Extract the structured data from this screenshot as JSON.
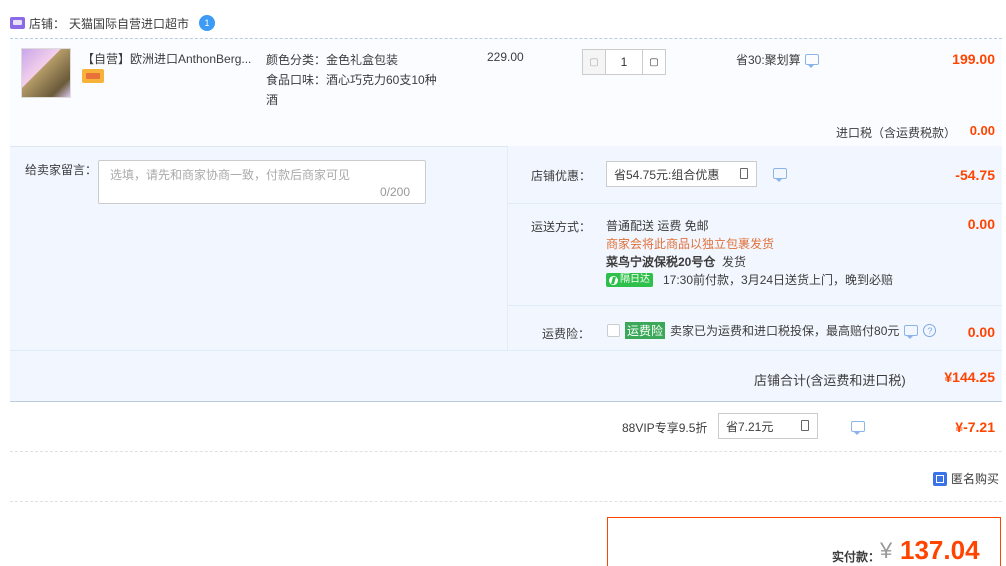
{
  "shop": {
    "label": "店铺：",
    "name": "天猫国际自营进口超市",
    "chat_badge": "1"
  },
  "item": {
    "title": "【自营】欧洲进口AnthonBerg...",
    "sku_color": "颜色分类：金色礼盒包装",
    "sku_taste_line1": "食品口味：酒心巧克力60支10种",
    "sku_taste_line2": "酒",
    "unit_price": "229.00",
    "qty": "1",
    "qty_minus": "▢",
    "qty_plus": "▢",
    "promo": "省30:聚划算",
    "total": "199.00"
  },
  "import_tax": {
    "label": "进口税（含运费税款）",
    "value": "0.00"
  },
  "message": {
    "label": "给卖家留言：",
    "placeholder": "选填，请先和商家协商一致，付款后商家可见",
    "count": "0/200"
  },
  "shop_discount": {
    "label": "店铺优惠：",
    "selected": "省54.75元:组合优惠",
    "value": "-54.75"
  },
  "delivery": {
    "label": "运送方式：",
    "method": "普通配送 运费 免邮",
    "notice": "商家会将此商品以独立包裹发货",
    "warehouse": "菜鸟宁波保税20号仓",
    "ship_label": "发货",
    "tag": "隔日达",
    "eta": "17:30前付款，3月24日送货上门，晚到必赔",
    "value": "0.00"
  },
  "insurance": {
    "label": "运费险：",
    "tag": "运费险",
    "text": "卖家已为运费和进口税投保，最高赔付80元",
    "help": "?",
    "value": "0.00"
  },
  "shop_total": {
    "label": "店铺合计(含运费和进口税)",
    "value": "¥144.25"
  },
  "vip": {
    "label": "88VIP专享9.5折",
    "selected": "省7.21元",
    "value": "¥-7.21"
  },
  "anonymous": {
    "label": "匿名购买"
  },
  "payment": {
    "label": "实付款：",
    "currency": "¥",
    "value": "137.04"
  },
  "colors": {
    "accent": "#ff4400",
    "panel": "#f2f7ff",
    "green": "#2ec04a"
  }
}
